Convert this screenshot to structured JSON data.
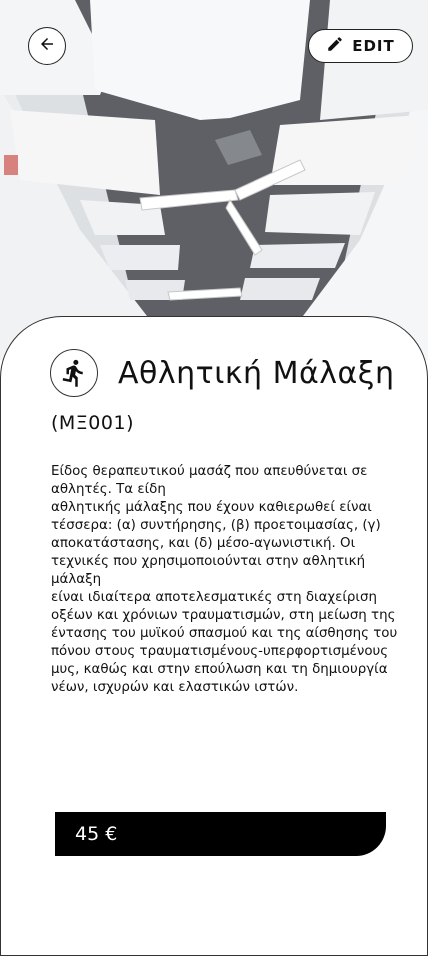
{
  "header": {
    "back_icon": "arrow-left-icon",
    "edit_label": "EDIT",
    "edit_icon": "pencil-icon"
  },
  "service": {
    "icon": "running-person-icon",
    "title": "Αθλητική Μάλαξη",
    "code": "(ΜΞ001)",
    "description": "Είδος θεραπευτικού μασάζ που απευθύνεται σε αθλητές. Τα είδη\nαθλητικής μάλαξης που έχουν καθιερωθεί είναι τέσσερα: (α) συντήρησης, (β) προετοιμασίας, (γ)\nαποκατάστασης, και (δ) μέσο-αγωνιστική. Οι τεχνικές που χρησιμοποιούνται στην αθλητική μάλαξη\nείναι ιδιαίτερα αποτελεσματικές στη διαχείριση οξέων και χρόνιων τραυματισμών, στη μείωση της\nέντασης του μυϊκού σπασμού και της αίσθησης του πόνου στους τραυματισμένους-υπερφορτισμένους\nμυς, καθώς και στην επούλωση και τη δημιουργία νέων, ισχυρών και ελαστικών ιστών.",
    "price": "45 €"
  },
  "colors": {
    "price_bar": "#000000",
    "card": "#ffffff"
  }
}
